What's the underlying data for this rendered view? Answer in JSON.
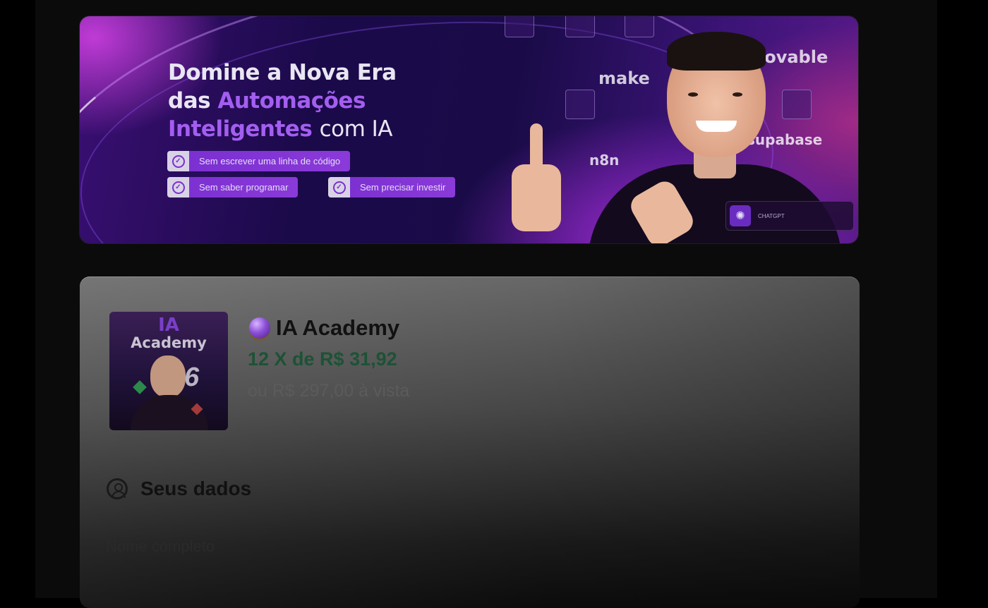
{
  "banner": {
    "headline_line1": "Domine a Nova Era",
    "headline_line2_a": "das",
    "headline_line2_b": "Automações",
    "headline_line3_a": "Inteligentes",
    "headline_line3_b": "com IA",
    "badges": [
      "Sem escrever uma linha de código",
      "Sem saber programar",
      "Sem precisar investir"
    ],
    "brands": [
      "lovable",
      "make",
      "supabase",
      "n8n"
    ],
    "chip_title": "CHATGPT"
  },
  "product": {
    "thumb_title_1": "IA",
    "thumb_title_2": "Academy",
    "thumb_number": "6",
    "name": "IA Academy",
    "installments": "12 X de R$ 31,92",
    "cash_price": "ou R$ 297,00 à vista"
  },
  "form": {
    "section_title": "Seus dados",
    "first_field_label": "Nome completo"
  },
  "colors": {
    "accent": "#7a2fd0",
    "price_green": "#1d5235"
  },
  "icons": [
    "check-circle-icon",
    "user-circle-icon",
    "crystal-ball-icon",
    "chatgpt-logo-icon"
  ]
}
